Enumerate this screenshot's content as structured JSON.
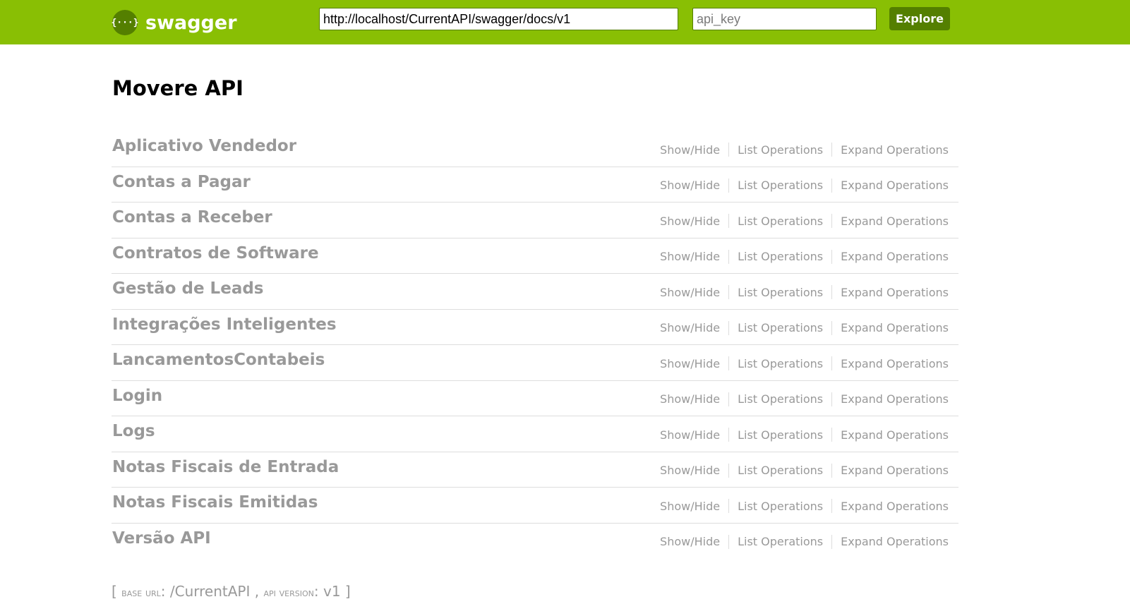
{
  "header": {
    "logo_glyph": "{···}",
    "brand": "swagger",
    "base_url_value": "http://localhost/CurrentAPI/swagger/docs/v1",
    "api_key_placeholder": "api_key",
    "explore_label": "Explore",
    "colors": {
      "bar": "#89bf04",
      "accent": "#547f00"
    }
  },
  "api_title": "Movere API",
  "resources": [
    {
      "name": "Aplicativo Vendedor",
      "show_hide": "Show/Hide",
      "list_ops": "List Operations",
      "expand_ops": "Expand Operations"
    },
    {
      "name": "Contas a Pagar",
      "show_hide": "Show/Hide",
      "list_ops": "List Operations",
      "expand_ops": "Expand Operations"
    },
    {
      "name": "Contas a Receber",
      "show_hide": "Show/Hide",
      "list_ops": "List Operations",
      "expand_ops": "Expand Operations"
    },
    {
      "name": "Contratos de Software",
      "show_hide": "Show/Hide",
      "list_ops": "List Operations",
      "expand_ops": "Expand Operations"
    },
    {
      "name": "Gestão de Leads",
      "show_hide": "Show/Hide",
      "list_ops": "List Operations",
      "expand_ops": "Expand Operations"
    },
    {
      "name": "Integrações Inteligentes",
      "show_hide": "Show/Hide",
      "list_ops": "List Operations",
      "expand_ops": "Expand Operations"
    },
    {
      "name": "LancamentosContabeis",
      "show_hide": "Show/Hide",
      "list_ops": "List Operations",
      "expand_ops": "Expand Operations"
    },
    {
      "name": "Login",
      "show_hide": "Show/Hide",
      "list_ops": "List Operations",
      "expand_ops": "Expand Operations"
    },
    {
      "name": "Logs",
      "show_hide": "Show/Hide",
      "list_ops": "List Operations",
      "expand_ops": "Expand Operations"
    },
    {
      "name": "Notas Fiscais de Entrada",
      "show_hide": "Show/Hide",
      "list_ops": "List Operations",
      "expand_ops": "Expand Operations"
    },
    {
      "name": "Notas Fiscais Emitidas",
      "show_hide": "Show/Hide",
      "list_ops": "List Operations",
      "expand_ops": "Expand Operations"
    },
    {
      "name": "Versão API",
      "show_hide": "Show/Hide",
      "list_ops": "List Operations",
      "expand_ops": "Expand Operations"
    }
  ],
  "footer": {
    "open_bracket": "[",
    "base_url_label": "base url",
    "base_url_value": "/CurrentAPI",
    "separator": ",",
    "api_version_label": "api version",
    "api_version_value": "v1",
    "close_bracket": "]"
  }
}
